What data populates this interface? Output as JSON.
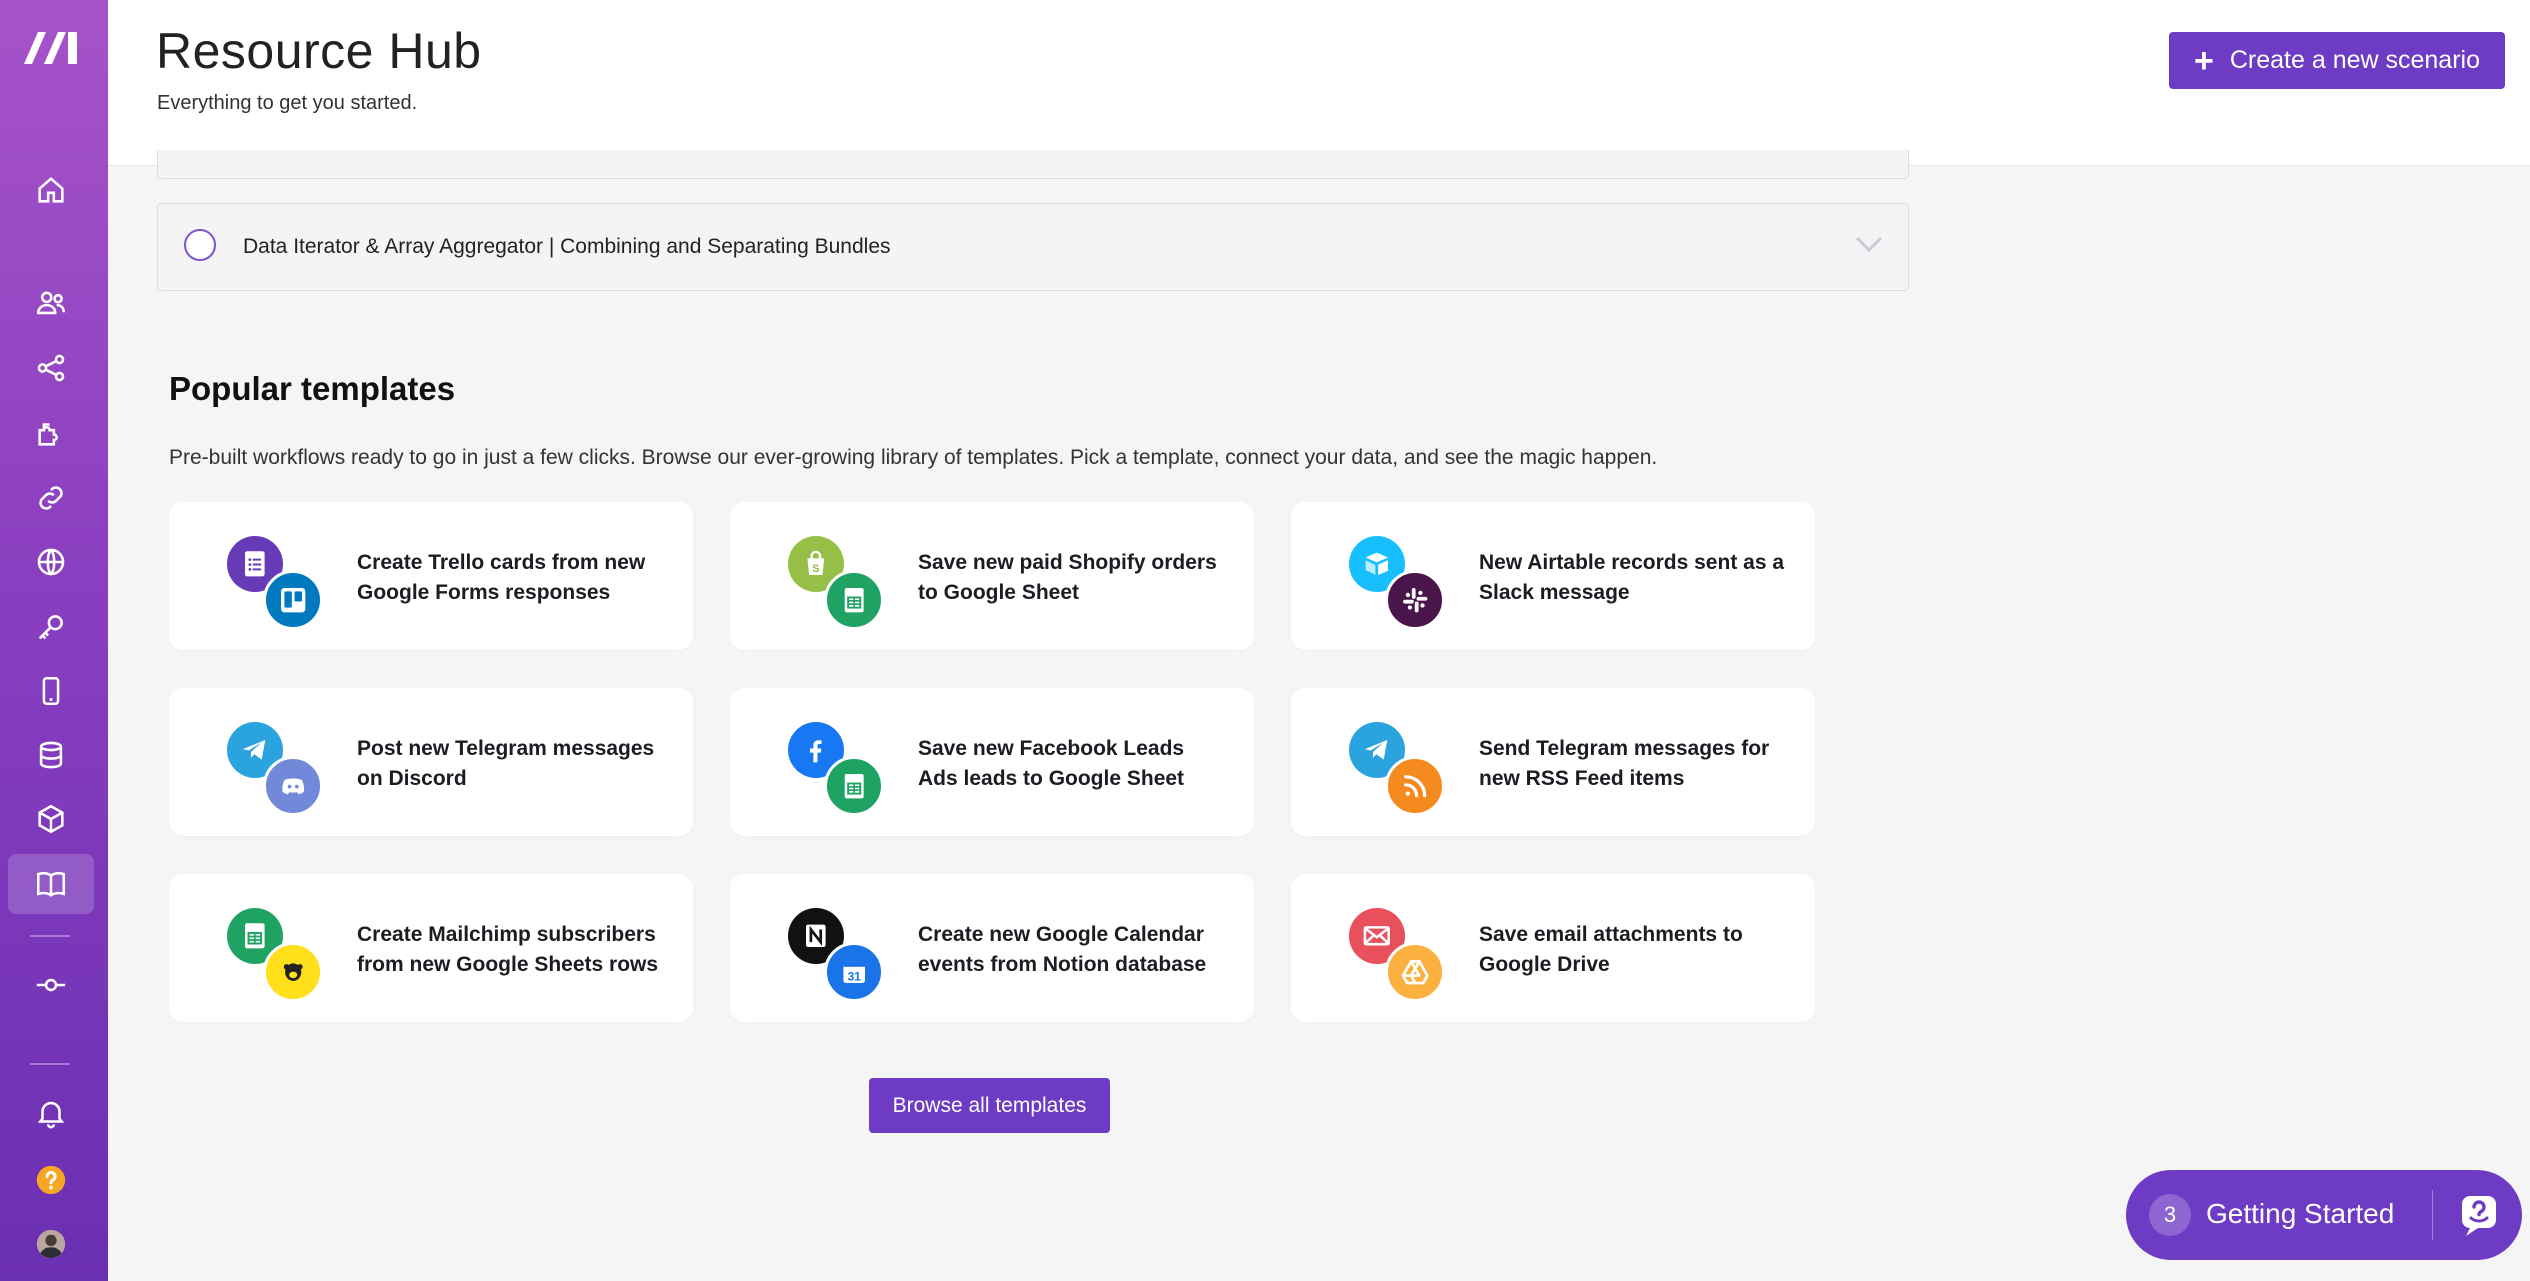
{
  "header": {
    "title": "Resource Hub",
    "subtitle": "Everything to get you started.",
    "create_button_label": "Create a new scenario"
  },
  "sidebar": {
    "items": [
      {
        "icon": "home-icon"
      },
      {
        "icon": "team-icon"
      },
      {
        "icon": "share-icon"
      },
      {
        "icon": "puzzle-icon"
      },
      {
        "icon": "link-icon"
      },
      {
        "icon": "globe-icon"
      },
      {
        "icon": "key-icon"
      },
      {
        "icon": "mobile-icon"
      },
      {
        "icon": "database-icon"
      },
      {
        "icon": "cube-icon"
      },
      {
        "icon": "book-icon",
        "active": true
      },
      {
        "icon": "commit-icon"
      },
      {
        "icon": "bell-icon"
      },
      {
        "icon": "help-icon"
      },
      {
        "icon": "avatar"
      }
    ]
  },
  "accordion": {
    "label": "Data Iterator & Array Aggregator | Combining and Separating Bundles"
  },
  "templates": {
    "title": "Popular templates",
    "description": "Pre-built workflows ready to go in just a few clicks. Browse our ever-growing library of templates. Pick a template, connect your data, and see the magic happen.",
    "items": [
      {
        "label": "Create Trello cards from new Google Forms responses",
        "icons": [
          "google-forms-icon",
          "trello-icon"
        ]
      },
      {
        "label": "Save new paid Shopify orders to Google Sheet",
        "icons": [
          "shopify-icon",
          "google-sheets-icon"
        ]
      },
      {
        "label": "New Airtable records sent as a Slack message",
        "icons": [
          "airtable-icon",
          "slack-icon"
        ]
      },
      {
        "label": "Post new Telegram messages on Discord",
        "icons": [
          "telegram-icon",
          "discord-icon"
        ]
      },
      {
        "label": "Save new Facebook Leads Ads leads to Google Sheet",
        "icons": [
          "facebook-icon",
          "google-sheets-icon"
        ]
      },
      {
        "label": "Send Telegram messages for new RSS Feed items",
        "icons": [
          "telegram-icon",
          "rss-icon"
        ]
      },
      {
        "label": "Create Mailchimp subscribers from new Google Sheets rows",
        "icons": [
          "google-sheets-icon",
          "mailchimp-icon"
        ]
      },
      {
        "label": "Create new Google Calendar events from Notion database",
        "icons": [
          "notion-icon",
          "google-calendar-icon"
        ]
      },
      {
        "label": "Save email attachments to Google Drive",
        "icons": [
          "email-icon",
          "google-drive-icon"
        ]
      }
    ],
    "browse_label": "Browse all templates"
  },
  "getting_started": {
    "count": "3",
    "label": "Getting Started"
  },
  "colors": {
    "accent": "#6d3bc4",
    "sidebar_top": "#a653c9",
    "sidebar_bottom": "#6b2fb3"
  }
}
